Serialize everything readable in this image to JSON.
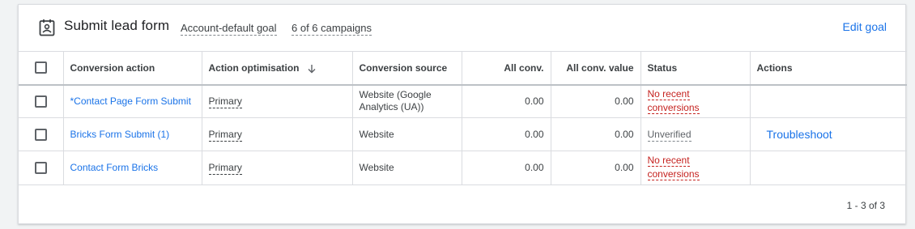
{
  "header": {
    "title": "Submit lead form",
    "account_goal": "Account-default goal",
    "campaigns": "6 of 6 campaigns",
    "edit_label": "Edit goal"
  },
  "table": {
    "columns": [
      "Conversion action",
      "Action optimisation",
      "Conversion source",
      "All conv.",
      "All conv. value",
      "Status",
      "Actions"
    ],
    "rows": [
      {
        "action": "*Contact Page Form Submit",
        "optimisation": "Primary",
        "source_line1": "Website (Google",
        "source_line2": "Analytics (UA))",
        "all_conv": "0.00",
        "all_conv_value": "0.00",
        "status_line1": "No recent",
        "status_line2": "conversions",
        "action_link": ""
      },
      {
        "action": "Bricks Form Submit (1)",
        "optimisation": "Primary",
        "source_line1": "Website",
        "source_line2": "",
        "all_conv": "0.00",
        "all_conv_value": "0.00",
        "status_line1": "Unverified",
        "status_line2": "",
        "action_link": "Troubleshoot"
      },
      {
        "action": "Contact Form Bricks",
        "optimisation": "Primary",
        "source_line1": "Website",
        "source_line2": "",
        "all_conv": "0.00",
        "all_conv_value": "0.00",
        "status_line1": "No recent",
        "status_line2": "conversions",
        "action_link": ""
      }
    ]
  },
  "footer": {
    "pagination": "1 - 3 of 3"
  },
  "icons": {
    "goal": "lead-form-icon",
    "sort": "arrow-down-icon"
  },
  "colors": {
    "accent": "#1a73e8",
    "error": "#c5221f"
  }
}
